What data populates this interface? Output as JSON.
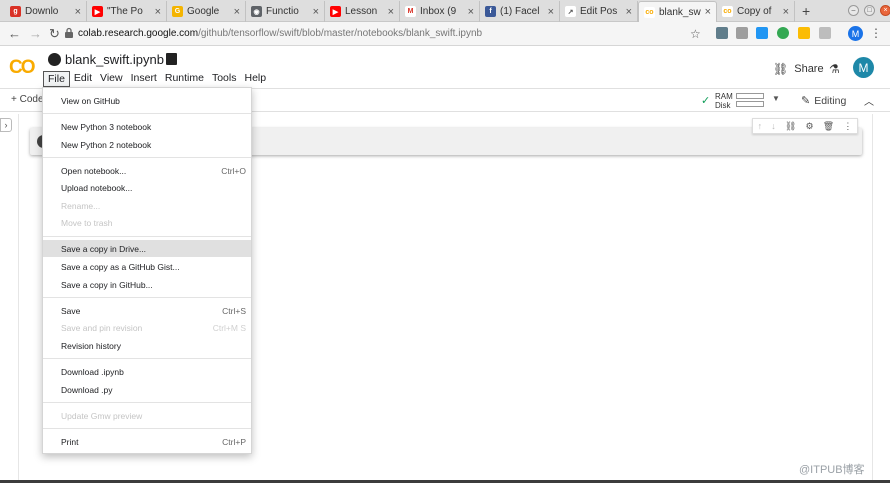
{
  "browser": {
    "tabs": [
      {
        "label": "Downlo",
        "fav_color": "#d93025",
        "fav_glyph": "g"
      },
      {
        "label": "\"The Po",
        "fav_color": "#ff0000",
        "fav_glyph": "▶"
      },
      {
        "label": "Google",
        "fav_color": "#f4b400",
        "fav_glyph": "G"
      },
      {
        "label": "Functio",
        "fav_color": "#5f6368",
        "fav_glyph": "◉"
      },
      {
        "label": "Lesson",
        "fav_color": "#ff0000",
        "fav_glyph": "▶"
      },
      {
        "label": "Inbox (9",
        "fav_color": "#ffffff",
        "fav_glyph": "M"
      },
      {
        "label": "(1) Facel",
        "fav_color": "#3b5998",
        "fav_glyph": "f"
      },
      {
        "label": "Edit Pos",
        "fav_color": "#ffffff",
        "fav_glyph": "↗"
      },
      {
        "label": "blank_sw",
        "fav_color": "#f9ab00",
        "fav_glyph": "co"
      },
      {
        "label": "Copy of",
        "fav_color": "#f9ab00",
        "fav_glyph": "co"
      }
    ],
    "tab_close_glyph": "×",
    "new_tab_glyph": "+",
    "url_host": "colab.research.google.com",
    "url_path": "/github/tensorflow/swift/blob/master/notebooks/blank_swift.ipynb",
    "profile_initial": "M"
  },
  "colab": {
    "logo_text": "CO",
    "notebook_title": "blank_swift.ipynb",
    "menu": [
      "File",
      "Edit",
      "View",
      "Insert",
      "Runtime",
      "Tools",
      "Help"
    ],
    "share_label": "Share",
    "avatar_initial": "M"
  },
  "toolbar": {
    "add_code_label": "+ Code",
    "ram_label": "RAM",
    "disk_label": "Disk",
    "editing_label": "Editing",
    "check_glyph": "✓"
  },
  "file_menu": {
    "items": [
      {
        "label": "View on GitHub",
        "shortcut": "",
        "disabled": false
      },
      {
        "label": "New Python 3 notebook",
        "shortcut": "",
        "disabled": false
      },
      {
        "label": "New Python 2 notebook",
        "shortcut": "",
        "disabled": false
      },
      {
        "label": "Open notebook...",
        "shortcut": "Ctrl+O",
        "disabled": false
      },
      {
        "label": "Upload notebook...",
        "shortcut": "",
        "disabled": false
      },
      {
        "label": "Rename...",
        "shortcut": "",
        "disabled": true
      },
      {
        "label": "Move to trash",
        "shortcut": "",
        "disabled": true
      },
      {
        "label": "Save a copy in Drive...",
        "shortcut": "",
        "disabled": false,
        "highlighted": true
      },
      {
        "label": "Save a copy as a GitHub Gist...",
        "shortcut": "",
        "disabled": false
      },
      {
        "label": "Save a copy in GitHub...",
        "shortcut": "",
        "disabled": false
      },
      {
        "label": "Save",
        "shortcut": "Ctrl+S",
        "disabled": false
      },
      {
        "label": "Save and pin revision",
        "shortcut": "Ctrl+M S",
        "disabled": true
      },
      {
        "label": "Revision history",
        "shortcut": "",
        "disabled": false
      },
      {
        "label": "Download .ipynb",
        "shortcut": "",
        "disabled": false
      },
      {
        "label": "Download .py",
        "shortcut": "",
        "disabled": false
      },
      {
        "label": "Update Gmw preview",
        "shortcut": "",
        "disabled": true
      },
      {
        "label": "Print",
        "shortcut": "Ctrl+P",
        "disabled": false
      }
    ]
  },
  "watermark": "@ITPUB博客"
}
